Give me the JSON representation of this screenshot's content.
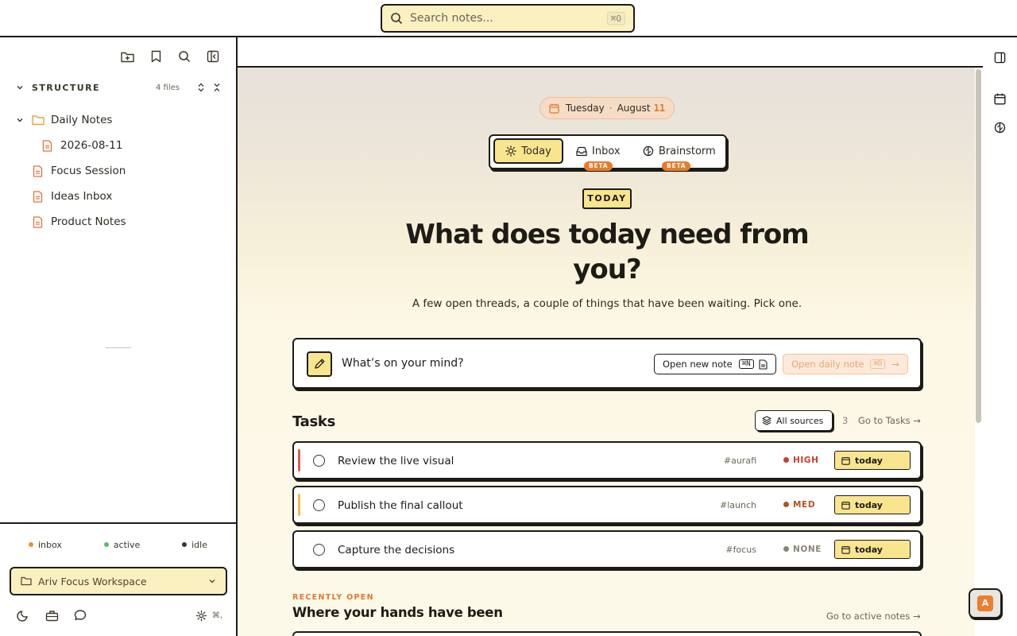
{
  "search": {
    "placeholder": "Search notes...",
    "shortcut": "⌘O"
  },
  "sidebar": {
    "section_label": "STRUCTURE",
    "file_count": "4 files",
    "tree": [
      {
        "name": "Daily Notes",
        "kind": "folder",
        "expanded": true
      },
      {
        "name": "2026-08-11",
        "kind": "file",
        "indent": 1
      },
      {
        "name": "Focus Session",
        "kind": "file"
      },
      {
        "name": "Ideas Inbox",
        "kind": "file"
      },
      {
        "name": "Product Notes",
        "kind": "file"
      }
    ],
    "legend": [
      {
        "label": "inbox",
        "color": "#e8912f"
      },
      {
        "label": "active",
        "color": "#5cb86a"
      },
      {
        "label": "idle",
        "color": "#3a3629"
      }
    ],
    "workspace": "Ariv Focus Workspace",
    "settings_shortcut": "⌘,"
  },
  "date": {
    "weekday": "Tuesday",
    "month": "August",
    "day": "11"
  },
  "modes": [
    {
      "label": "Today",
      "active": true,
      "badge": ""
    },
    {
      "label": "Inbox",
      "active": false,
      "badge": "BETA"
    },
    {
      "label": "Brainstorm",
      "active": false,
      "badge": "BETA"
    }
  ],
  "hero": {
    "badge": "TODAY",
    "headline": "What does today need from you?",
    "subline": "A few open threads, a couple of things that have been waiting. Pick one."
  },
  "compose": {
    "prompt": "What’s on your mind?",
    "new_note_label": "Open new note",
    "new_note_kbd": "⌘N",
    "daily_note_label": "Open daily note",
    "daily_note_kbd": "⌘D"
  },
  "tasks": {
    "heading": "Tasks",
    "filter_label": "All sources",
    "count": "3",
    "go_label": "Go to Tasks →",
    "items": [
      {
        "title": "Review the live visual",
        "tag": "#aurafi",
        "priority": "HIGH",
        "priority_color": "#d13b2c",
        "bar_color": "#e05a4f",
        "due": "today"
      },
      {
        "title": "Publish the final callout",
        "tag": "#launch",
        "priority": "MED",
        "priority_color": "#b5521f",
        "bar_color": "#f0c04a",
        "due": "today"
      },
      {
        "title": "Capture the decisions",
        "tag": "#focus",
        "priority": "NONE",
        "priority_color": "#8a8473",
        "bar_color": "",
        "due": "today"
      }
    ]
  },
  "recent": {
    "kicker": "RECENTLY OPEN",
    "heading": "Where your hands have been",
    "go_label": "Go to active notes →"
  },
  "fab_letter": "A",
  "colors": {
    "accent": "#fae58f",
    "brand_orange": "#e87b2c",
    "ink": "#1d1b16"
  }
}
